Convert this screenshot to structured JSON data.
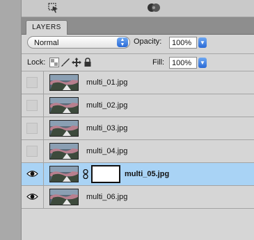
{
  "panel": {
    "tab_label": "LAYERS",
    "blend_mode": "Normal",
    "opacity_label": "Opacity:",
    "opacity_value": "100%",
    "lock_label": "Lock:",
    "fill_label": "Fill:",
    "fill_value": "100%"
  },
  "icons": {
    "toolbar_left": "select-tool-icon",
    "toolbar_right": "paint-bucket-icon",
    "blend_arrow": "updown-arrows-icon",
    "lock_transparent": "checker-icon",
    "lock_image": "brush-icon",
    "lock_position": "move-icon",
    "lock_all": "padlock-icon"
  },
  "layers": [
    {
      "name": "multi_01.jpg",
      "visible": false,
      "selected": false,
      "has_mask": false
    },
    {
      "name": "multi_02.jpg",
      "visible": false,
      "selected": false,
      "has_mask": false
    },
    {
      "name": "multi_03.jpg",
      "visible": false,
      "selected": false,
      "has_mask": false
    },
    {
      "name": "multi_04.jpg",
      "visible": false,
      "selected": false,
      "has_mask": false
    },
    {
      "name": "multi_05.jpg",
      "visible": true,
      "selected": true,
      "has_mask": true
    },
    {
      "name": "multi_06.jpg",
      "visible": true,
      "selected": false,
      "has_mask": false
    }
  ],
  "colors": {
    "selected_row": "#a9d3f5",
    "accent_blue": "#2a6ad6"
  }
}
